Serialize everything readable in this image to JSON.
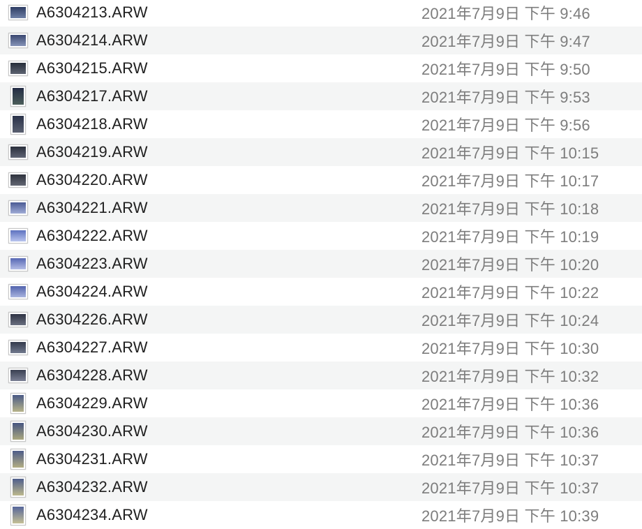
{
  "files": [
    {
      "name": "A6304213.ARW",
      "date": "2021年7月9日 下午 9:46",
      "thumb": "landscape",
      "colors": [
        "#2d3c63",
        "#6f80a6"
      ]
    },
    {
      "name": "A6304214.ARW",
      "date": "2021年7月9日 下午 9:47",
      "thumb": "landscape",
      "colors": [
        "#3a4770",
        "#8694b8"
      ]
    },
    {
      "name": "A6304215.ARW",
      "date": "2021年7月9日 下午 9:50",
      "thumb": "landscape",
      "colors": [
        "#262d3a",
        "#5e6472"
      ]
    },
    {
      "name": "A6304217.ARW",
      "date": "2021年7月9日 下午 9:53",
      "thumb": "portrait",
      "colors": [
        "#232c44",
        "#4c5e5a"
      ]
    },
    {
      "name": "A6304218.ARW",
      "date": "2021年7月9日 下午 9:56",
      "thumb": "portrait",
      "colors": [
        "#2a3249",
        "#5a6070"
      ]
    },
    {
      "name": "A6304219.ARW",
      "date": "2021年7月9日 下午 10:15",
      "thumb": "landscape",
      "colors": [
        "#2a2f3c",
        "#5f6474"
      ]
    },
    {
      "name": "A6304220.ARW",
      "date": "2021年7月9日 下午 10:17",
      "thumb": "landscape",
      "colors": [
        "#2f333d",
        "#626673"
      ]
    },
    {
      "name": "A6304221.ARW",
      "date": "2021年7月9日 下午 10:18",
      "thumb": "landscape",
      "colors": [
        "#4a5a95",
        "#a0acd6"
      ]
    },
    {
      "name": "A6304222.ARW",
      "date": "2021年7月9日 下午 10:19",
      "thumb": "landscape",
      "colors": [
        "#5e72c0",
        "#b9c4ee"
      ]
    },
    {
      "name": "A6304223.ARW",
      "date": "2021年7月9日 下午 10:20",
      "thumb": "landscape",
      "colors": [
        "#5667b4",
        "#b4bde6"
      ]
    },
    {
      "name": "A6304224.ARW",
      "date": "2021年7月9日 下午 10:22",
      "thumb": "landscape",
      "colors": [
        "#5263ad",
        "#a9b3df"
      ]
    },
    {
      "name": "A6304226.ARW",
      "date": "2021年7月9日 下午 10:24",
      "thumb": "landscape",
      "colors": [
        "#2f3444",
        "#6a6f80"
      ]
    },
    {
      "name": "A6304227.ARW",
      "date": "2021年7月9日 下午 10:30",
      "thumb": "landscape",
      "colors": [
        "#333a4c",
        "#727a8e"
      ]
    },
    {
      "name": "A6304228.ARW",
      "date": "2021年7月9日 下午 10:32",
      "thumb": "landscape",
      "colors": [
        "#3a4052",
        "#7b8094"
      ]
    },
    {
      "name": "A6304229.ARW",
      "date": "2021年7月9日 下午 10:36",
      "thumb": "portrait",
      "colors": [
        "#4a5a86",
        "#b7b48a"
      ]
    },
    {
      "name": "A6304230.ARW",
      "date": "2021年7月9日 下午 10:36",
      "thumb": "portrait",
      "colors": [
        "#465580",
        "#aaa87f"
      ]
    },
    {
      "name": "A6304231.ARW",
      "date": "2021年7月9日 下午 10:37",
      "thumb": "portrait",
      "colors": [
        "#4d5c88",
        "#b3ae84"
      ]
    },
    {
      "name": "A6304232.ARW",
      "date": "2021年7月9日 下午 10:37",
      "thumb": "portrait",
      "colors": [
        "#4f5f8c",
        "#bdb98d"
      ]
    },
    {
      "name": "A6304234.ARW",
      "date": "2021年7月9日 下午 10:39",
      "thumb": "portrait",
      "colors": [
        "#56669a",
        "#c5c096"
      ]
    }
  ]
}
